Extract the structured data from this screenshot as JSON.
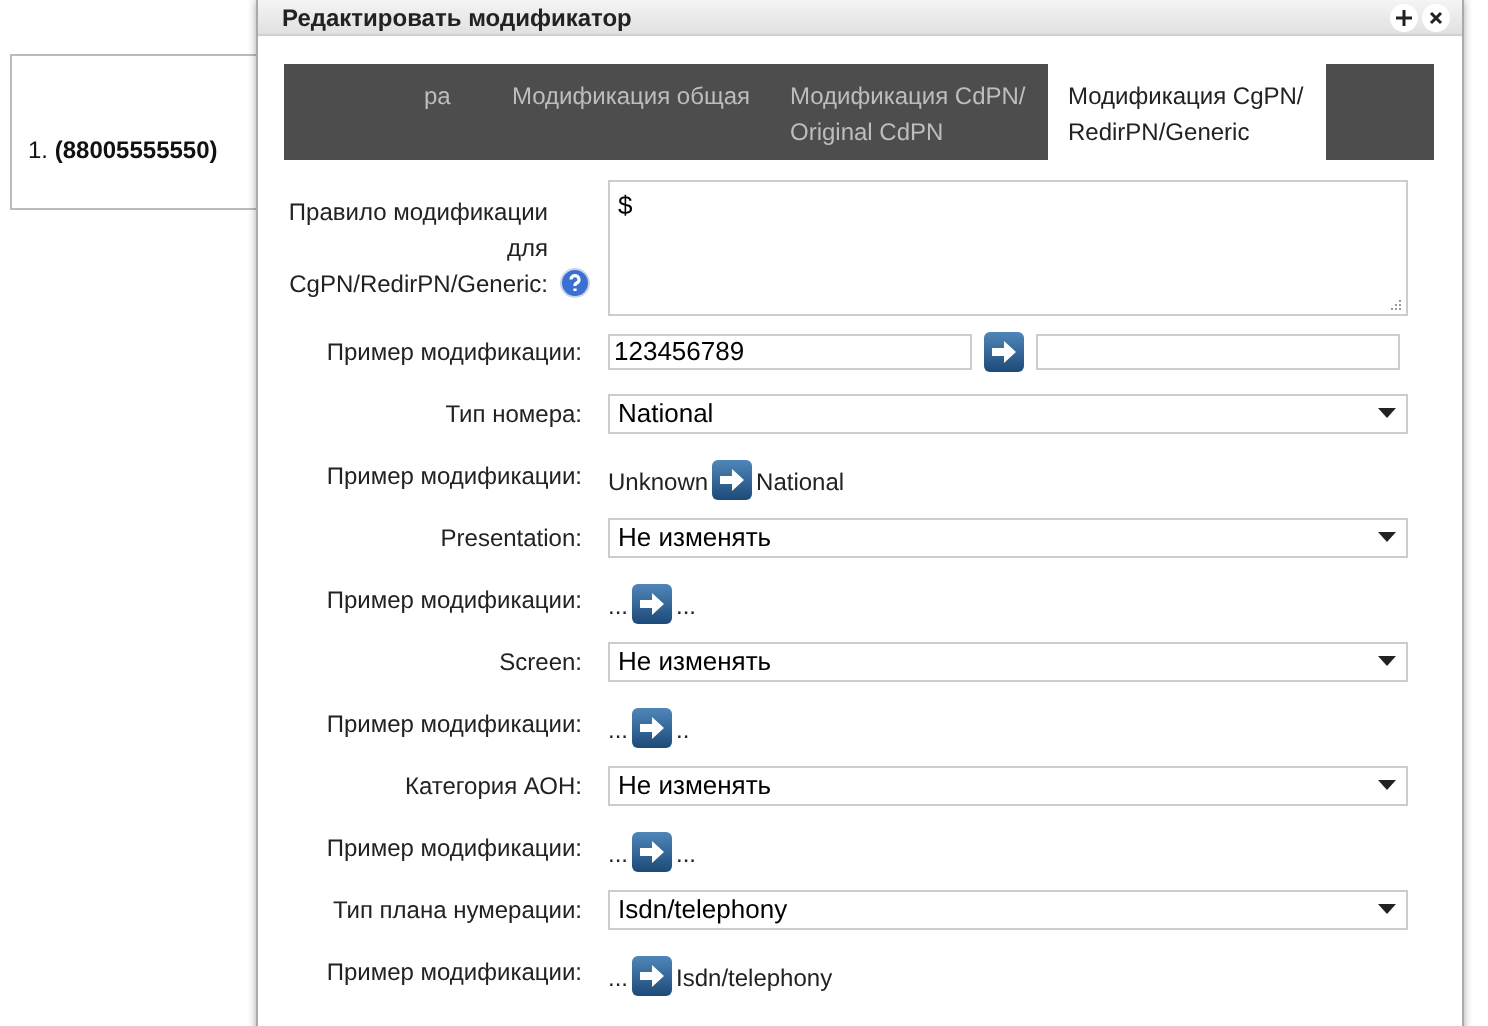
{
  "side_panel": {
    "items": [
      {
        "number": "1.",
        "value": "(88005555550)"
      }
    ]
  },
  "dialog": {
    "title": "Редактировать модификатор"
  },
  "tabs": [
    {
      "label": "ра",
      "selected": false
    },
    {
      "label": "Модификация общая",
      "selected": false
    },
    {
      "label": "Модификация CdPN/ Original CdPN",
      "selected": false
    },
    {
      "label": "Модификация CgPN/ RedirPN/Generic",
      "selected": true
    }
  ],
  "rows": [
    {
      "kind": "textarea",
      "label": "Правило модификации для CgPN/RedirPN/Generic:",
      "value": "$",
      "help": true
    },
    {
      "kind": "example_input",
      "label": "Пример модификации:",
      "value": "123456789"
    },
    {
      "kind": "select",
      "label": "Тип номера:",
      "value": "National"
    },
    {
      "kind": "example",
      "label": "Пример модификации:",
      "from": "Unknown",
      "to": "National"
    },
    {
      "kind": "select",
      "label": "Presentation:",
      "value": "Не изменять"
    },
    {
      "kind": "example",
      "label": "Пример модификации:",
      "from": "...",
      "to": "..."
    },
    {
      "kind": "select",
      "label": "Screen:",
      "value": "Не изменять"
    },
    {
      "kind": "example",
      "label": "Пример модификации:",
      "from": "...",
      "to": ".."
    },
    {
      "kind": "select",
      "label": "Категория АОН:",
      "value": "Не изменять"
    },
    {
      "kind": "example",
      "label": "Пример модификации:",
      "from": "...",
      "to": "..."
    },
    {
      "kind": "select",
      "label": "Тип плана нумерации:",
      "value": "Isdn/telephony"
    },
    {
      "kind": "example",
      "label": "Пример модификации:",
      "from": "...",
      "to": "Isdn/telephony"
    }
  ]
}
